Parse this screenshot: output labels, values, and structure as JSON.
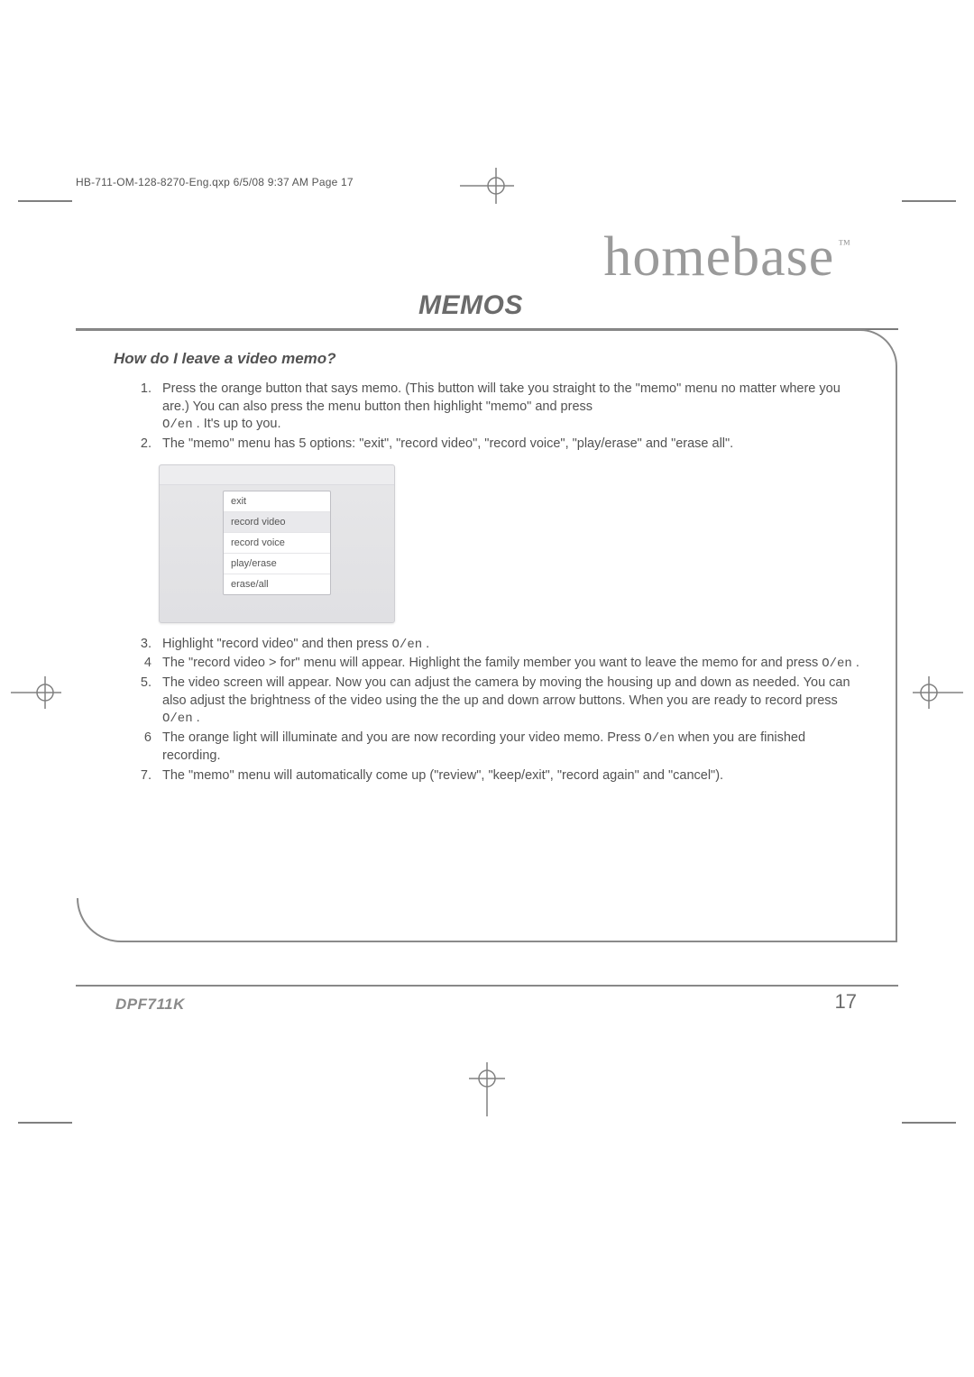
{
  "header_slug": "HB-711-OM-128-8270-Eng.qxp  6/5/08  9:37 AM  Page 17",
  "brand": {
    "strong": "home",
    "light": "base",
    "tm": "™"
  },
  "title": "MEMOS",
  "question": "How do I leave a video memo?",
  "steps": {
    "s1a": "Press the orange button that says memo. (This button will take you straight to the \"memo\" menu no matter where you are.) You can also press the menu button then highlight \"memo\" and press ",
    "s1key": "O/en",
    "s1b": ". It's up to you.",
    "s2": "The \"memo\" menu has 5 options: \"exit\", \"record video\", \"record voice\", \"play/erase\" and \"erase all\".",
    "s3a": "Highlight \"record video\" and then press ",
    "s3key": "O/en",
    "s3b": ".",
    "s4a": "The \"record video > for\" menu will appear.  Highlight the family member you want to leave the memo for and press ",
    "s4key": "O/en",
    "s4b": ".",
    "s5a": "The video screen will appear.  Now you can adjust the camera by moving the housing up and down as needed.  You can also adjust the brightness of the video using the the up and down arrow buttons.  When you are ready to record press ",
    "s5key": "O/en",
    "s5b": ".",
    "s6a": "The orange light will illuminate and you are now recording your video memo. Press ",
    "s6key": "O/en",
    "s6b": " when you are finished recording.",
    "s7": "The \"memo\" menu will automatically come up (\"review\", \"keep/exit\", \"record again\" and \"cancel\")."
  },
  "nums": {
    "n1": "1.",
    "n2": "2.",
    "n3": "3.",
    "n4": "4",
    "n5": "5.",
    "n6": "6",
    "n7": "7."
  },
  "menu": {
    "i0": "exit",
    "i1": "record video",
    "i2": "record voice",
    "i3": "play/erase",
    "i4": "erase/all"
  },
  "model": "DPF711K",
  "pageno": "17"
}
